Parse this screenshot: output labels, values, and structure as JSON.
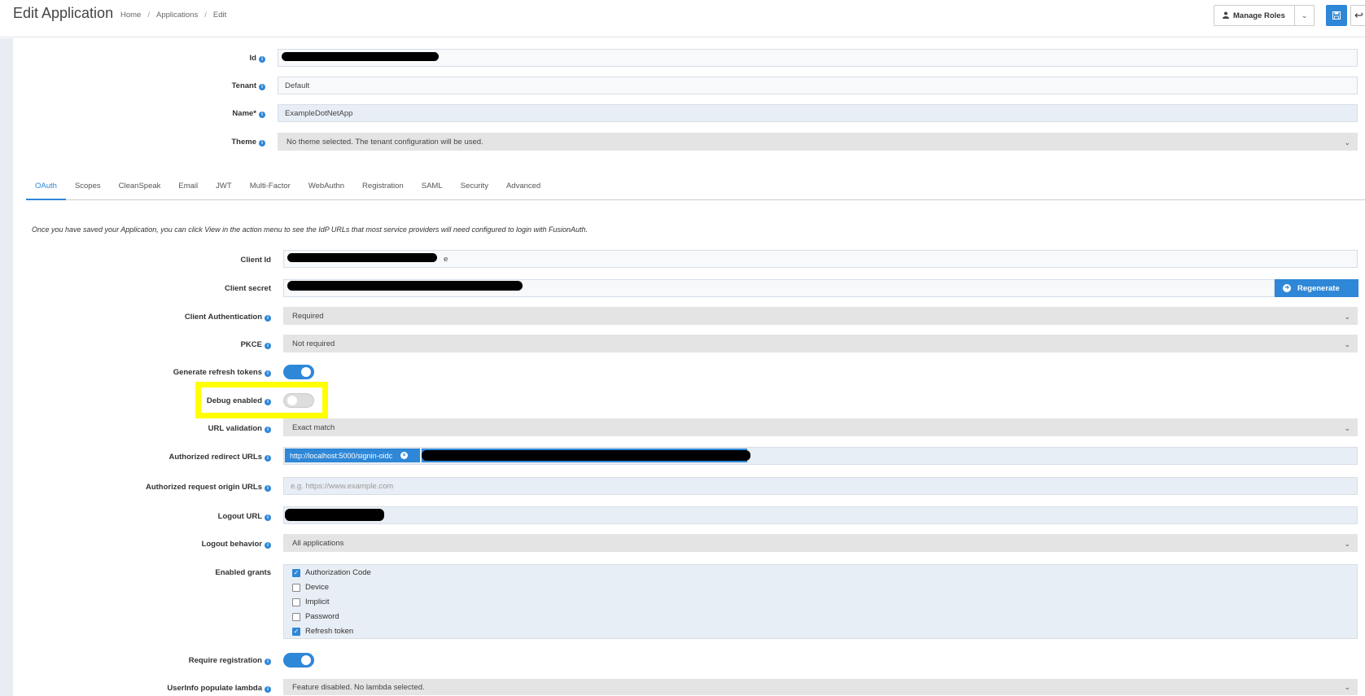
{
  "header": {
    "title": "Edit Application",
    "breadcrumb": [
      "Home",
      "Applications",
      "Edit"
    ],
    "breadcrumb_sep": "/",
    "manage_roles_label": "Manage Roles"
  },
  "icons": {
    "info": "i",
    "chevron": "⌄",
    "check": "✓",
    "back": "↩"
  },
  "colors": {
    "accent": "#2e87d7",
    "highlight": "#ffff00"
  },
  "form": {
    "id_label": "Id",
    "tenant_label": "Tenant",
    "tenant_value": "Default",
    "name_label": "Name*",
    "name_value": "ExampleDotNetApp",
    "theme_label": "Theme",
    "theme_value": "No theme selected. The tenant configuration will be used."
  },
  "tabs": [
    "OAuth",
    "Scopes",
    "CleanSpeak",
    "Email",
    "JWT",
    "Multi-Factor",
    "WebAuthn",
    "Registration",
    "SAML",
    "Security",
    "Advanced"
  ],
  "oauth": {
    "note": "Once you have saved your Application, you can click View in the action menu to see the IdP URLs that most service providers will need configured to login with FusionAuth.",
    "client_id_label": "Client Id",
    "client_id_tail": "e",
    "client_secret_label": "Client secret",
    "regenerate_label": "Regenerate",
    "client_auth_label": "Client Authentication",
    "client_auth_value": "Required",
    "pkce_label": "PKCE",
    "pkce_value": "Not required",
    "refresh_label": "Generate refresh tokens",
    "refresh_on": true,
    "debug_label": "Debug enabled",
    "debug_on": false,
    "url_validation_label": "URL validation",
    "url_validation_value": "Exact match",
    "redirect_label": "Authorized redirect URLs",
    "redirect_chip": "http://localhost:5000/signin-oidc",
    "origin_label": "Authorized request origin URLs",
    "origin_placeholder": "e.g. https://www.example.com",
    "logout_url_label": "Logout URL",
    "logout_behavior_label": "Logout behavior",
    "logout_behavior_value": "All applications",
    "grants_label": "Enabled grants",
    "grants": [
      {
        "label": "Authorization Code",
        "checked": true
      },
      {
        "label": "Device",
        "checked": false
      },
      {
        "label": "Implicit",
        "checked": false
      },
      {
        "label": "Password",
        "checked": false
      },
      {
        "label": "Refresh token",
        "checked": true
      }
    ],
    "require_registration_label": "Require registration",
    "require_registration_on": true,
    "userinfo_label": "UserInfo populate lambda",
    "userinfo_value": "Feature disabled. No lambda selected."
  }
}
